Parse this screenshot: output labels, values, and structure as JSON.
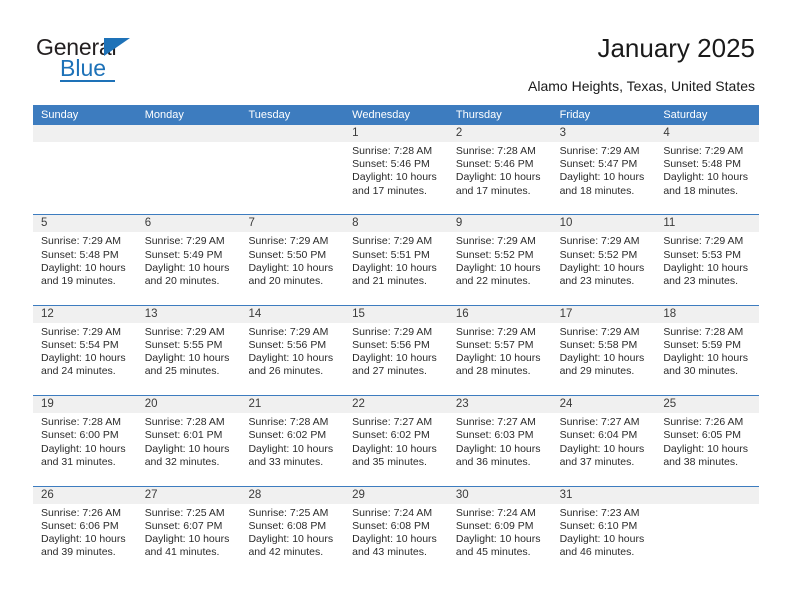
{
  "brand": {
    "name_top": "General",
    "name_bottom": "Blue",
    "accent_color": "#1e72b8"
  },
  "header": {
    "title": "January 2025",
    "subtitle": "Alamo Heights, Texas, United States"
  },
  "calendar": {
    "header_bg": "#3d7cbf",
    "stripe_bg": "#f0f0f0",
    "weekday_headers": [
      "Sunday",
      "Monday",
      "Tuesday",
      "Wednesday",
      "Thursday",
      "Friday",
      "Saturday"
    ],
    "weeks": [
      [
        {
          "day": "",
          "empty": true
        },
        {
          "day": "",
          "empty": true
        },
        {
          "day": "",
          "empty": true
        },
        {
          "day": "1",
          "sunrise": "Sunrise: 7:28 AM",
          "sunset": "Sunset: 5:46 PM",
          "daylight_1": "Daylight: 10 hours",
          "daylight_2": "and 17 minutes."
        },
        {
          "day": "2",
          "sunrise": "Sunrise: 7:28 AM",
          "sunset": "Sunset: 5:46 PM",
          "daylight_1": "Daylight: 10 hours",
          "daylight_2": "and 17 minutes."
        },
        {
          "day": "3",
          "sunrise": "Sunrise: 7:29 AM",
          "sunset": "Sunset: 5:47 PM",
          "daylight_1": "Daylight: 10 hours",
          "daylight_2": "and 18 minutes."
        },
        {
          "day": "4",
          "sunrise": "Sunrise: 7:29 AM",
          "sunset": "Sunset: 5:48 PM",
          "daylight_1": "Daylight: 10 hours",
          "daylight_2": "and 18 minutes."
        }
      ],
      [
        {
          "day": "5",
          "sunrise": "Sunrise: 7:29 AM",
          "sunset": "Sunset: 5:48 PM",
          "daylight_1": "Daylight: 10 hours",
          "daylight_2": "and 19 minutes."
        },
        {
          "day": "6",
          "sunrise": "Sunrise: 7:29 AM",
          "sunset": "Sunset: 5:49 PM",
          "daylight_1": "Daylight: 10 hours",
          "daylight_2": "and 20 minutes."
        },
        {
          "day": "7",
          "sunrise": "Sunrise: 7:29 AM",
          "sunset": "Sunset: 5:50 PM",
          "daylight_1": "Daylight: 10 hours",
          "daylight_2": "and 20 minutes."
        },
        {
          "day": "8",
          "sunrise": "Sunrise: 7:29 AM",
          "sunset": "Sunset: 5:51 PM",
          "daylight_1": "Daylight: 10 hours",
          "daylight_2": "and 21 minutes."
        },
        {
          "day": "9",
          "sunrise": "Sunrise: 7:29 AM",
          "sunset": "Sunset: 5:52 PM",
          "daylight_1": "Daylight: 10 hours",
          "daylight_2": "and 22 minutes."
        },
        {
          "day": "10",
          "sunrise": "Sunrise: 7:29 AM",
          "sunset": "Sunset: 5:52 PM",
          "daylight_1": "Daylight: 10 hours",
          "daylight_2": "and 23 minutes."
        },
        {
          "day": "11",
          "sunrise": "Sunrise: 7:29 AM",
          "sunset": "Sunset: 5:53 PM",
          "daylight_1": "Daylight: 10 hours",
          "daylight_2": "and 23 minutes."
        }
      ],
      [
        {
          "day": "12",
          "sunrise": "Sunrise: 7:29 AM",
          "sunset": "Sunset: 5:54 PM",
          "daylight_1": "Daylight: 10 hours",
          "daylight_2": "and 24 minutes."
        },
        {
          "day": "13",
          "sunrise": "Sunrise: 7:29 AM",
          "sunset": "Sunset: 5:55 PM",
          "daylight_1": "Daylight: 10 hours",
          "daylight_2": "and 25 minutes."
        },
        {
          "day": "14",
          "sunrise": "Sunrise: 7:29 AM",
          "sunset": "Sunset: 5:56 PM",
          "daylight_1": "Daylight: 10 hours",
          "daylight_2": "and 26 minutes."
        },
        {
          "day": "15",
          "sunrise": "Sunrise: 7:29 AM",
          "sunset": "Sunset: 5:56 PM",
          "daylight_1": "Daylight: 10 hours",
          "daylight_2": "and 27 minutes."
        },
        {
          "day": "16",
          "sunrise": "Sunrise: 7:29 AM",
          "sunset": "Sunset: 5:57 PM",
          "daylight_1": "Daylight: 10 hours",
          "daylight_2": "and 28 minutes."
        },
        {
          "day": "17",
          "sunrise": "Sunrise: 7:29 AM",
          "sunset": "Sunset: 5:58 PM",
          "daylight_1": "Daylight: 10 hours",
          "daylight_2": "and 29 minutes."
        },
        {
          "day": "18",
          "sunrise": "Sunrise: 7:28 AM",
          "sunset": "Sunset: 5:59 PM",
          "daylight_1": "Daylight: 10 hours",
          "daylight_2": "and 30 minutes."
        }
      ],
      [
        {
          "day": "19",
          "sunrise": "Sunrise: 7:28 AM",
          "sunset": "Sunset: 6:00 PM",
          "daylight_1": "Daylight: 10 hours",
          "daylight_2": "and 31 minutes."
        },
        {
          "day": "20",
          "sunrise": "Sunrise: 7:28 AM",
          "sunset": "Sunset: 6:01 PM",
          "daylight_1": "Daylight: 10 hours",
          "daylight_2": "and 32 minutes."
        },
        {
          "day": "21",
          "sunrise": "Sunrise: 7:28 AM",
          "sunset": "Sunset: 6:02 PM",
          "daylight_1": "Daylight: 10 hours",
          "daylight_2": "and 33 minutes."
        },
        {
          "day": "22",
          "sunrise": "Sunrise: 7:27 AM",
          "sunset": "Sunset: 6:02 PM",
          "daylight_1": "Daylight: 10 hours",
          "daylight_2": "and 35 minutes."
        },
        {
          "day": "23",
          "sunrise": "Sunrise: 7:27 AM",
          "sunset": "Sunset: 6:03 PM",
          "daylight_1": "Daylight: 10 hours",
          "daylight_2": "and 36 minutes."
        },
        {
          "day": "24",
          "sunrise": "Sunrise: 7:27 AM",
          "sunset": "Sunset: 6:04 PM",
          "daylight_1": "Daylight: 10 hours",
          "daylight_2": "and 37 minutes."
        },
        {
          "day": "25",
          "sunrise": "Sunrise: 7:26 AM",
          "sunset": "Sunset: 6:05 PM",
          "daylight_1": "Daylight: 10 hours",
          "daylight_2": "and 38 minutes."
        }
      ],
      [
        {
          "day": "26",
          "sunrise": "Sunrise: 7:26 AM",
          "sunset": "Sunset: 6:06 PM",
          "daylight_1": "Daylight: 10 hours",
          "daylight_2": "and 39 minutes."
        },
        {
          "day": "27",
          "sunrise": "Sunrise: 7:25 AM",
          "sunset": "Sunset: 6:07 PM",
          "daylight_1": "Daylight: 10 hours",
          "daylight_2": "and 41 minutes."
        },
        {
          "day": "28",
          "sunrise": "Sunrise: 7:25 AM",
          "sunset": "Sunset: 6:08 PM",
          "daylight_1": "Daylight: 10 hours",
          "daylight_2": "and 42 minutes."
        },
        {
          "day": "29",
          "sunrise": "Sunrise: 7:24 AM",
          "sunset": "Sunset: 6:08 PM",
          "daylight_1": "Daylight: 10 hours",
          "daylight_2": "and 43 minutes."
        },
        {
          "day": "30",
          "sunrise": "Sunrise: 7:24 AM",
          "sunset": "Sunset: 6:09 PM",
          "daylight_1": "Daylight: 10 hours",
          "daylight_2": "and 45 minutes."
        },
        {
          "day": "31",
          "sunrise": "Sunrise: 7:23 AM",
          "sunset": "Sunset: 6:10 PM",
          "daylight_1": "Daylight: 10 hours",
          "daylight_2": "and 46 minutes."
        },
        {
          "day": "",
          "empty": true
        }
      ]
    ]
  }
}
